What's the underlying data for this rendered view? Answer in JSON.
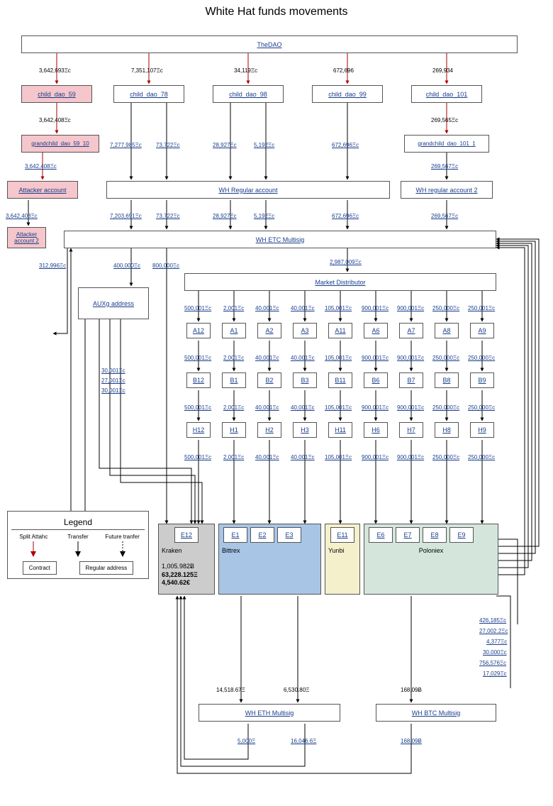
{
  "title": "White Hat funds movements",
  "nodes": {
    "thedao": "TheDAO",
    "cd59": "child_dao_59",
    "cd78": "child_dao_78",
    "cd98": "child_dao_98",
    "cd99": "child_dao_99",
    "cd101": "child_dao_101",
    "gd59": "grandchild_dao_59_10",
    "gd101": "grandchild_dao_101_1",
    "atk": "Attacker account",
    "atk2": "Attacker account 2",
    "whreg": "WH Regular account",
    "whreg2": "WH regular account 2",
    "whetc": "WH ETC Multisig",
    "aux": "AUXg address",
    "mdist": "Market Distributor",
    "wheth": "WH ETH Multisig",
    "whbtc": "WH BTC Multisig",
    "kraken": "Kraken",
    "bittrex": "Bittrex",
    "yunbi": "Yunbi",
    "poloniex": "Poloniex",
    "A12": "A12",
    "A1": "A1",
    "A2": "A2",
    "A3": "A3",
    "A11": "A11",
    "A6": "A6",
    "A7": "A7",
    "A8": "A8",
    "A9": "A9",
    "B12": "B12",
    "B1": "B1",
    "B2": "B2",
    "B3": "B3",
    "B11": "B11",
    "B6": "B6",
    "B7": "B7",
    "B8": "B8",
    "B9": "B9",
    "H12": "H12",
    "H1": "H1",
    "H2": "H2",
    "H3": "H3",
    "H11": "H11",
    "H6": "H6",
    "H7": "H7",
    "H8": "H8",
    "H9": "H9",
    "E12": "E12",
    "E1": "E1",
    "E2": "E2",
    "E3": "E3",
    "E11": "E11",
    "E6": "E6",
    "E7": "E7",
    "E8": "E8",
    "E9": "E9"
  },
  "amts": {
    "tdao_59": "3,642,693Ξc",
    "tdao_78": "7,351,107Ξc",
    "tdao_98": "34,119Ξc",
    "tdao_99": "672,696",
    "tdao_101": "269,934",
    "cd59_gd": "3,642,408Ξc",
    "cd101_gd": "269,565Ξc",
    "gd59_atk": "3,642,408Ξc",
    "atk_atk2": "3,642,408Ξc",
    "whreg_a": "7,277,985Ξc",
    "whreg_b": "73,722Ξc",
    "whreg_c": "28,927Ξc",
    "whreg_d": "5,192Ξc",
    "whreg_e": "672,696Ξc",
    "whreg2_a": "269,567Ξc",
    "etc_a": "7,203,691Ξc",
    "etc_b": "73,722Ξc",
    "etc_c": "28,927Ξc",
    "etc_d": "5,192Ξc",
    "etc_e": "672,696Ξc",
    "etc_f": "269,567Ξc",
    "aux_in": "312,996Ξc",
    "etc_400": "400,000Ξc",
    "etc_800": "800,000Ξc",
    "etc_m": "2,987,009Ξc",
    "aux_30a": "30,001Ξc",
    "aux_27": "27,001Ξc",
    "aux_30b": "30,001Ξc",
    "row_vals": [
      "500,001Ξc",
      "2,001Ξc",
      "40,001Ξc",
      "40,001Ξc",
      "105,001Ξc",
      "900,001Ξc",
      "900,001Ξc",
      "250,000Ξc",
      "250,001Ξc"
    ],
    "row2_vals": [
      "500,001Ξc",
      "2,001Ξc",
      "40,001Ξc",
      "40,001Ξc",
      "105,001Ξc",
      "900,001Ξc",
      "900,001Ξc",
      "250,000Ξc",
      "250,000Ξc"
    ],
    "row3_vals": [
      "500,001Ξc",
      "2,001Ξc",
      "40,001Ξc",
      "40,001Ξc",
      "105,001Ξc",
      "900,001Ξc",
      "900,001Ξc",
      "250,000Ξc",
      "250,000Ξc"
    ],
    "row4_vals": [
      "500,001Ξc",
      "2,001Ξc",
      "40,001Ξc",
      "40,001Ξc",
      "105,001Ξc",
      "900,001Ξc",
      "900,001Ξc",
      "250,000Ξc",
      "250,000Ξc"
    ],
    "out_426": "426,185Ξc",
    "out_27": "27,002.2Ξc",
    "out_4": "4,377Ξc",
    "out_30": "30,000Ξc",
    "out_756": "756,576Ξc",
    "out_17": "17,029Ξc",
    "wheth_in1": "14,518.67Ξ",
    "wheth_in2": "6,530.80Ξ",
    "whbtc_in": "168,09Ƀ",
    "wheth_o1": "5,000Ξ",
    "wheth_o2": "16,046.6Ξ",
    "whbtc_o": "168,09Ƀ"
  },
  "kraken_vals": {
    "btc": "1,005.982Ƀ",
    "eth": "63,228.125Ξ",
    "eur": "4,540.62€"
  },
  "legend": {
    "title": "Legend",
    "split": "Split Attahc",
    "transfer": "Transfer",
    "future": "Future tranfer",
    "contract": "Contract",
    "regular": "Regular address"
  }
}
